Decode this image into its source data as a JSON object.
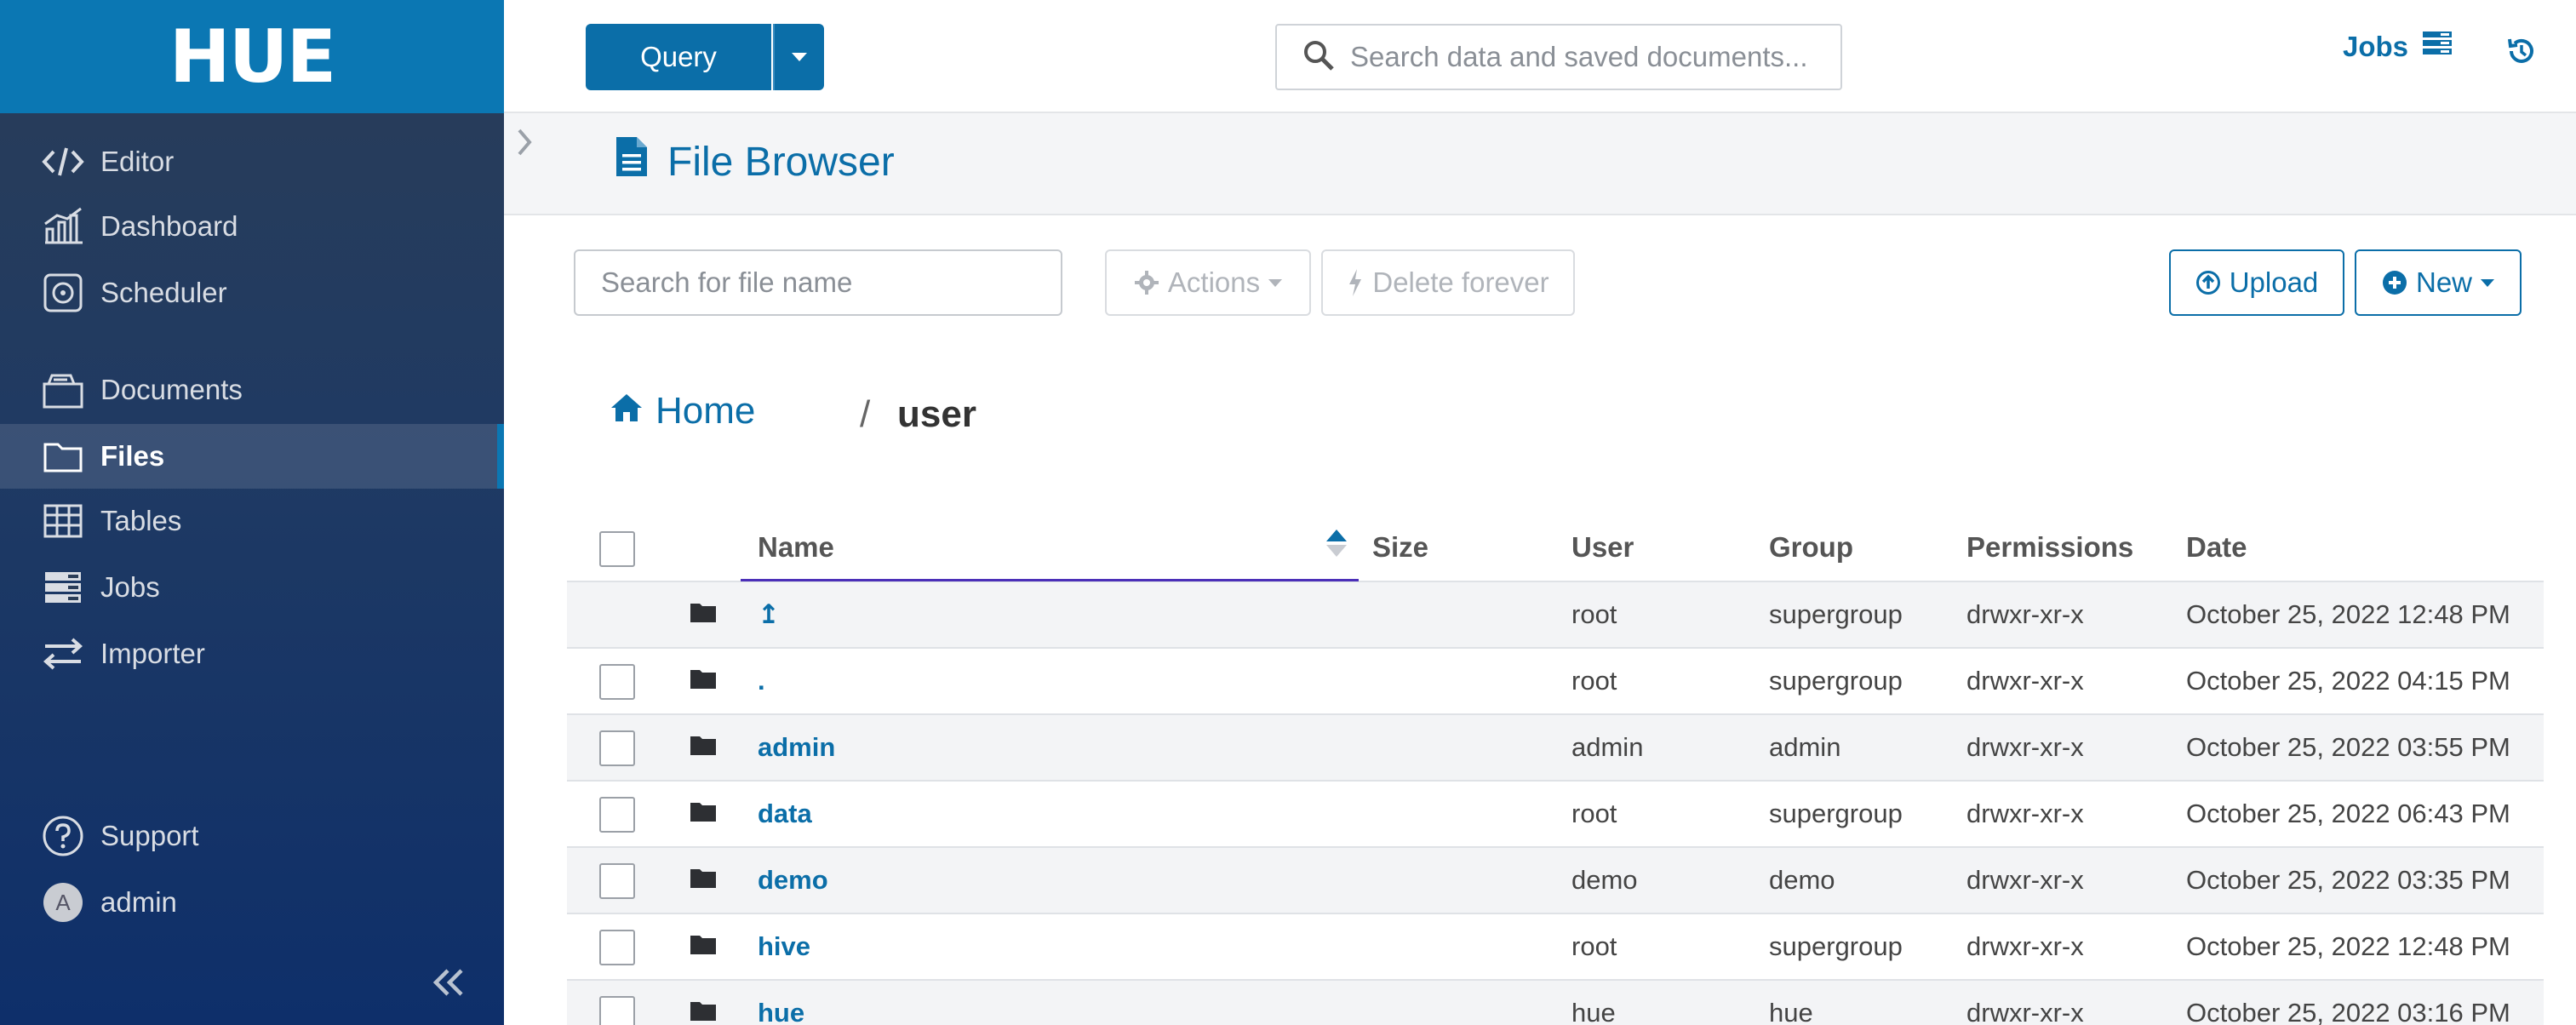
{
  "app": {
    "logo": "HUE"
  },
  "sidebar": {
    "items": [
      {
        "label": "Editor",
        "icon": "code-icon"
      },
      {
        "label": "Dashboard",
        "icon": "chart-icon"
      },
      {
        "label": "Scheduler",
        "icon": "scheduler-icon"
      },
      {
        "label": "Documents",
        "icon": "documents-icon"
      },
      {
        "label": "Files",
        "icon": "folder-icon",
        "active": true
      },
      {
        "label": "Tables",
        "icon": "table-icon"
      },
      {
        "label": "Jobs",
        "icon": "jobs-icon"
      },
      {
        "label": "Importer",
        "icon": "importer-icon"
      }
    ],
    "support_label": "Support",
    "user": {
      "avatar_letter": "A",
      "name": "admin"
    }
  },
  "topbar": {
    "query_label": "Query",
    "search_placeholder": "Search data and saved documents...",
    "jobs_label": "Jobs"
  },
  "header": {
    "title": "File Browser"
  },
  "toolbar": {
    "file_search_placeholder": "Search for file name",
    "actions_label": "Actions",
    "delete_label": "Delete forever",
    "upload_label": "Upload",
    "new_label": "New"
  },
  "breadcrumb": {
    "home_label": "Home",
    "separator": "/",
    "current": "user"
  },
  "table": {
    "columns": {
      "name": "Name",
      "size": "Size",
      "user": "User",
      "group": "Group",
      "permissions": "Permissions",
      "date": "Date"
    },
    "rows": [
      {
        "name": "↥",
        "size": "",
        "user": "root",
        "group": "supergroup",
        "permissions": "drwxr-xr-x",
        "date": "October 25, 2022 12:48 PM",
        "checkbox": false
      },
      {
        "name": ".",
        "size": "",
        "user": "root",
        "group": "supergroup",
        "permissions": "drwxr-xr-x",
        "date": "October 25, 2022 04:15 PM",
        "checkbox": true
      },
      {
        "name": "admin",
        "size": "",
        "user": "admin",
        "group": "admin",
        "permissions": "drwxr-xr-x",
        "date": "October 25, 2022 03:55 PM",
        "checkbox": true
      },
      {
        "name": "data",
        "size": "",
        "user": "root",
        "group": "supergroup",
        "permissions": "drwxr-xr-x",
        "date": "October 25, 2022 06:43 PM",
        "checkbox": true
      },
      {
        "name": "demo",
        "size": "",
        "user": "demo",
        "group": "demo",
        "permissions": "drwxr-xr-x",
        "date": "October 25, 2022 03:35 PM",
        "checkbox": true
      },
      {
        "name": "hive",
        "size": "",
        "user": "root",
        "group": "supergroup",
        "permissions": "drwxr-xr-x",
        "date": "October 25, 2022 12:48 PM",
        "checkbox": true
      },
      {
        "name": "hue",
        "size": "",
        "user": "hue",
        "group": "hue",
        "permissions": "drwxr-xr-x",
        "date": "October 25, 2022 03:16 PM",
        "checkbox": true
      }
    ]
  },
  "colors": {
    "brand": "#0b77b3",
    "link": "#0b6ea8",
    "sidebar_dark": "#0e2f6a",
    "sort_accent": "#4b2fb8"
  }
}
